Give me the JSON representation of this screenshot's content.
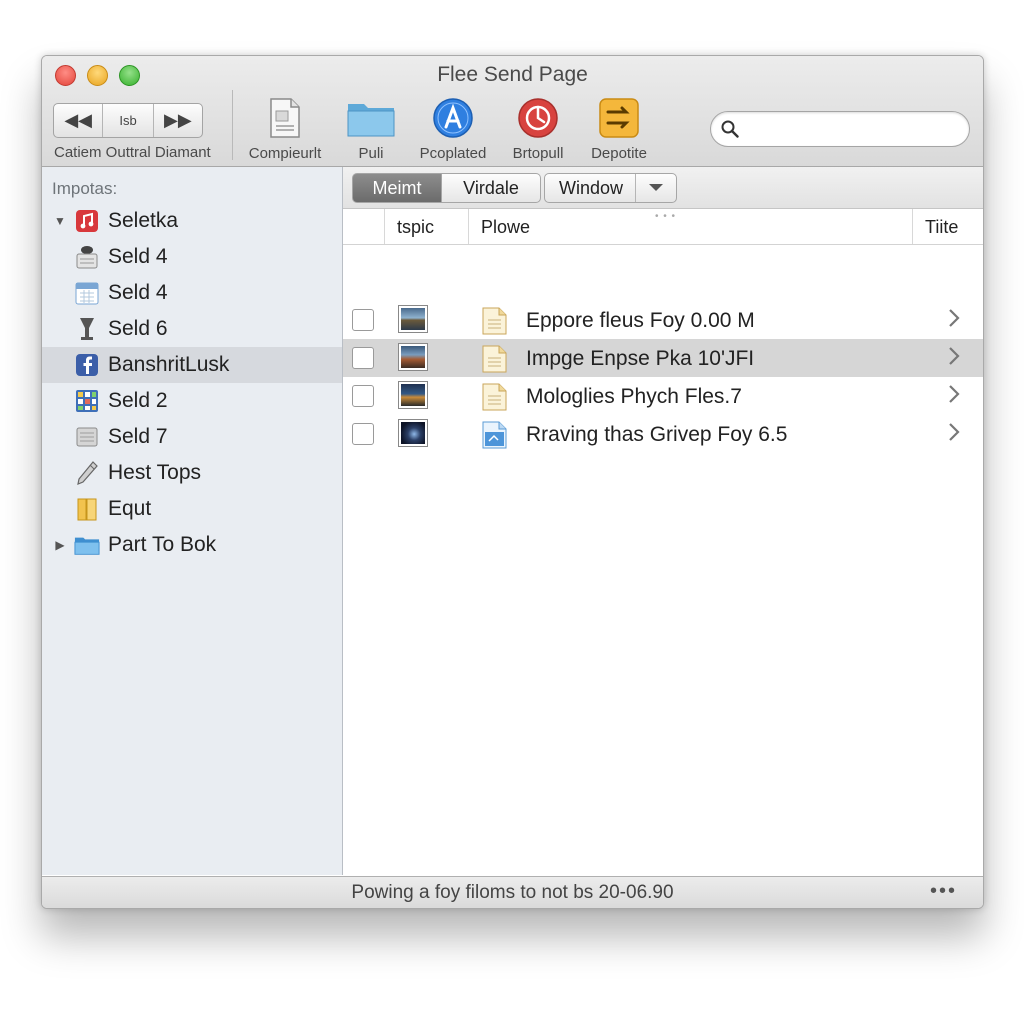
{
  "window": {
    "title": "Flee Send Page"
  },
  "toolbar": {
    "nav_middle_label": "Isb",
    "nav_group_label": "Catiem Outtral Diamant",
    "tools": [
      {
        "label": "Compieurlt",
        "icon": "document-icon"
      },
      {
        "label": "Puli",
        "icon": "folder-icon"
      },
      {
        "label": "Pcoplated",
        "icon": "app-store-icon"
      },
      {
        "label": "Brtopull",
        "icon": "red-circle-app-icon"
      },
      {
        "label": "Depotite",
        "icon": "export-icon"
      }
    ],
    "search": {
      "placeholder": "",
      "value": ""
    }
  },
  "sidebar": {
    "heading": "Impotas:",
    "items": [
      {
        "label": "Seletka",
        "icon": "music-icon",
        "disclosure": "expanded"
      },
      {
        "label": "Seld 4",
        "icon": "disk-icon"
      },
      {
        "label": "Seld 4",
        "icon": "calendar-icon"
      },
      {
        "label": "Seld 6",
        "icon": "glass-icon"
      },
      {
        "label": "BanshritLusk",
        "icon": "facebook-icon",
        "selected": true
      },
      {
        "label": "Seld 2",
        "icon": "grid-icon"
      },
      {
        "label": "Seld 7",
        "icon": "drive-icon"
      },
      {
        "label": "Hest Tops",
        "icon": "pen-icon"
      },
      {
        "label": "Equt",
        "icon": "book-icon"
      },
      {
        "label": "Part To Bok",
        "icon": "folder-icon",
        "disclosure": "collapsed"
      }
    ]
  },
  "tabs": {
    "t1": "Meimt",
    "t2": "Virdale",
    "t3": "Window"
  },
  "columns": {
    "c1": "tspic",
    "c2": "Plowe",
    "c3": "Tiite"
  },
  "rows": [
    {
      "name": "Eppore fleus Foy 0.00 M",
      "selected": false
    },
    {
      "name": "Impge  Enpse Pka 10'JFI",
      "selected": true
    },
    {
      "name": "Mologlies Phych Fles.7",
      "selected": false
    },
    {
      "name": "Rraving thas Grivep Foy 6.5",
      "selected": false
    }
  ],
  "status": {
    "text": "Powing a foy filoms to not bs 20-06.90",
    "more": "•••"
  },
  "colors": {
    "selection": "#d6d6d6",
    "sidebar_bg": "#e9edf2",
    "toolbar_bg": "#dedede"
  }
}
